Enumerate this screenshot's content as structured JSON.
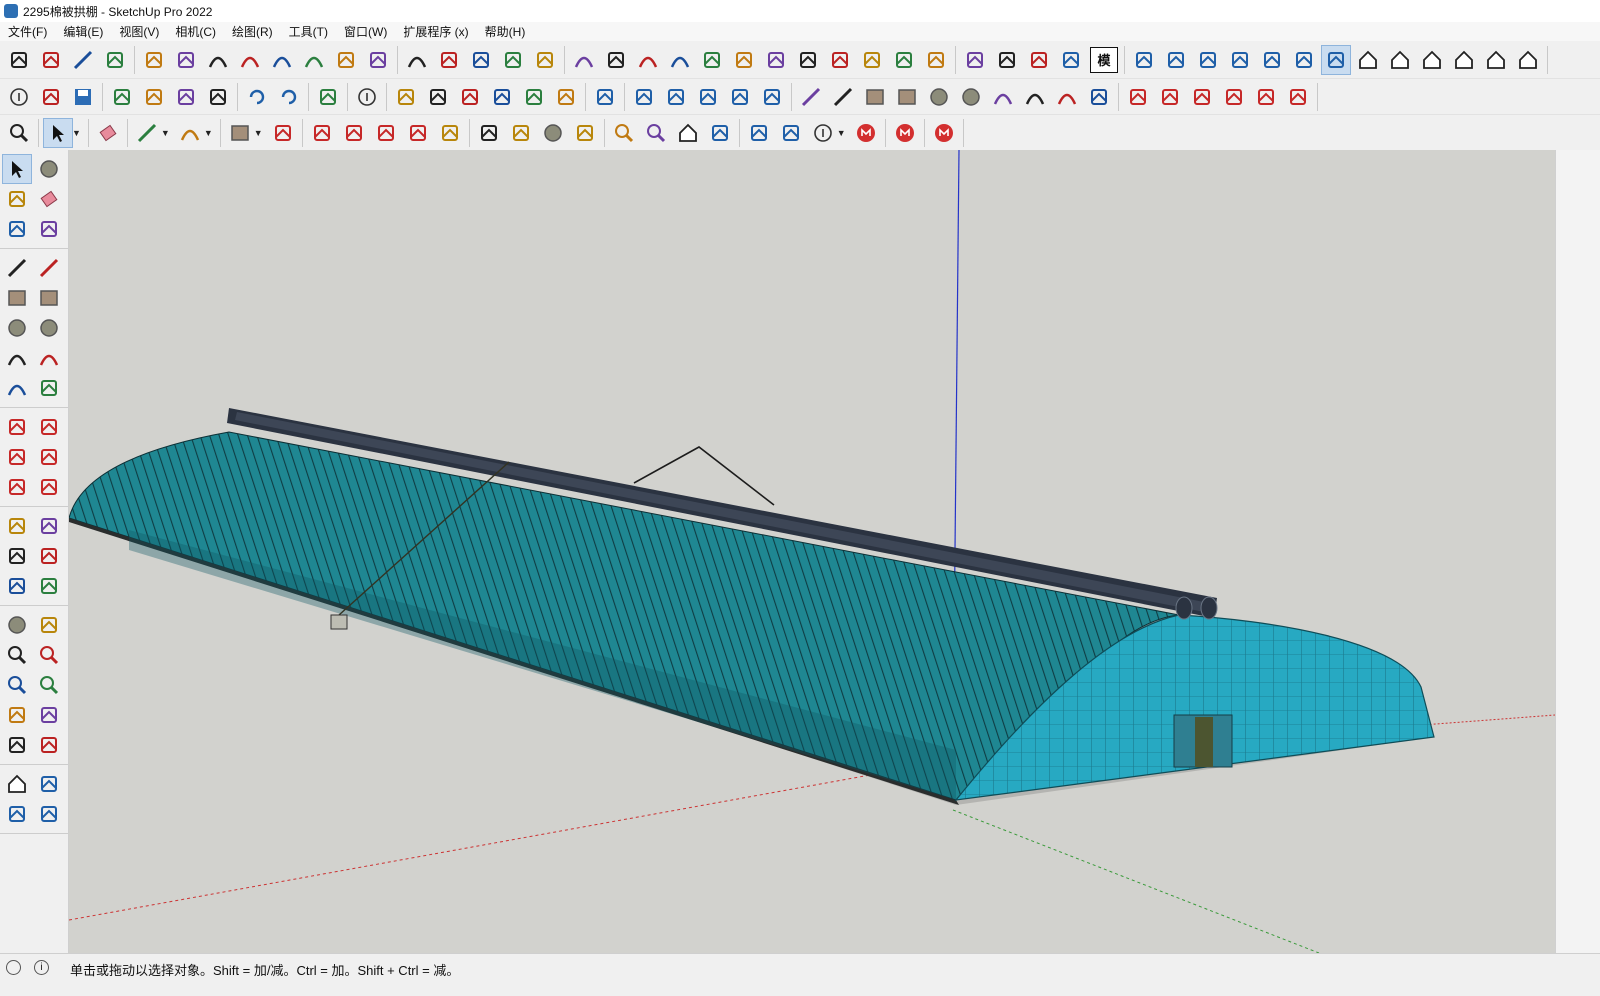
{
  "window": {
    "title": "2295棉被拱棚 - SketchUp Pro 2022"
  },
  "menu": [
    "文件(F)",
    "编辑(E)",
    "视图(V)",
    "相机(C)",
    "绘图(R)",
    "工具(T)",
    "窗口(W)",
    "扩展程序 (x)",
    "帮助(H)"
  ],
  "toolbar_text_buttons": [
    "模"
  ],
  "status": {
    "hint": "单击或拖动以选择对象。Shift = 加/减。Ctrl = 加。Shift + Ctrl = 减。"
  },
  "colors": {
    "canvas": "#d2d2ce",
    "greenhouse": "#1e8a95",
    "greenhouse_end": "#23a8c0",
    "roller": "#2b3341",
    "blue_axis": "#2433c9",
    "red_axis": "#cc3333",
    "green_axis": "#3a9a3a"
  },
  "icons": {
    "row1": [
      "push-pull-icon",
      "table-icon",
      "line-icon",
      "bars-icon",
      "align-icon",
      "dimension-icon",
      "curve-icon",
      "curve2-icon",
      "arch-icon",
      "loop-icon",
      "fan-icon",
      "stack-icon",
      "dash-curve-icon",
      "grid-icon",
      "plate-icon",
      "box-icon",
      "paint-icon",
      "arc-icon",
      "chain-icon",
      "wave-icon",
      "spiral-icon",
      "ruler-icon",
      "comb-icon",
      "columns-icon",
      "mirror-icon",
      "dots-icon",
      "panel-icon",
      "pen-icon",
      "brush-icon",
      "list-icon",
      "snow-icon",
      "env-icon",
      "iso-icon",
      "top-icon",
      "front-icon",
      "right-icon",
      "back-icon",
      "left-icon",
      "layers-icon",
      "bottom-icon",
      "house-a-icon",
      "house-b-icon",
      "home-icon",
      "house-c-icon",
      "house-d-icon",
      "house-e-icon"
    ],
    "row2": [
      "new-icon",
      "open-icon",
      "save-icon",
      "cut-icon",
      "copy-icon",
      "paste-icon",
      "delete-icon",
      "undo-icon",
      "redo-icon",
      "print-icon",
      "info-icon",
      "tape-icon",
      "dimension-icon",
      "protractor-icon",
      "text-icon",
      "axes-icon",
      "3dtext-icon",
      "component-icon",
      "group-a-icon",
      "group-b-icon",
      "group-c-icon",
      "group-d-icon",
      "group-e-icon",
      "pencil-icon",
      "freehand-icon",
      "rectangle-icon",
      "rotated-rect-icon",
      "circle-icon",
      "polygon-icon",
      "arc-icon",
      "arc2-icon",
      "arc3-icon",
      "pie-icon",
      "move-icon",
      "pushpull-icon",
      "rotate-icon",
      "followme-icon",
      "scale-icon",
      "offset-icon"
    ],
    "row3": [
      "zoom-icon",
      "select-icon",
      "eraser-icon",
      "pencil-icon",
      "arc-icon",
      "rectangle-icon",
      "pushpull-icon",
      "followme-icon",
      "move-icon",
      "rotate-icon",
      "scale-icon",
      "tape-icon",
      "text-icon",
      "paint-icon",
      "orbit-icon",
      "pan-icon",
      "zoom-icon",
      "zoom-extents-icon",
      "warehouse-icon",
      "extension-icon",
      "layers-icon",
      "extension2-icon",
      "account-icon",
      "ruby-icon",
      "ruby2-icon",
      "ruby3-icon"
    ],
    "left": [
      "select-icon",
      "orbit-icon",
      "paint-icon",
      "eraser-icon",
      "component-icon",
      "tag-icon",
      "pencil-icon",
      "freehand-icon",
      "rectangle-icon",
      "rotated-rect-icon",
      "circle-icon",
      "polygon-icon",
      "arc-icon",
      "arc2-icon",
      "arc3-icon",
      "pie-icon",
      "move-icon",
      "pushpull-icon",
      "rotate-icon",
      "followme-icon",
      "scale-icon",
      "offset-icon",
      "tape-icon",
      "dimension-icon",
      "protractor-icon",
      "text-icon",
      "axes-icon",
      "3dtext-icon",
      "orbit2-icon",
      "pan-icon",
      "zoom-icon",
      "zoom-window-icon",
      "zoom-extents-icon",
      "zoom-prev-icon",
      "position-camera-icon",
      "look-around-icon",
      "walk-icon",
      "section-icon",
      "warehouse-icon",
      "extension-icon",
      "layers-icon",
      "extension2-icon"
    ]
  }
}
